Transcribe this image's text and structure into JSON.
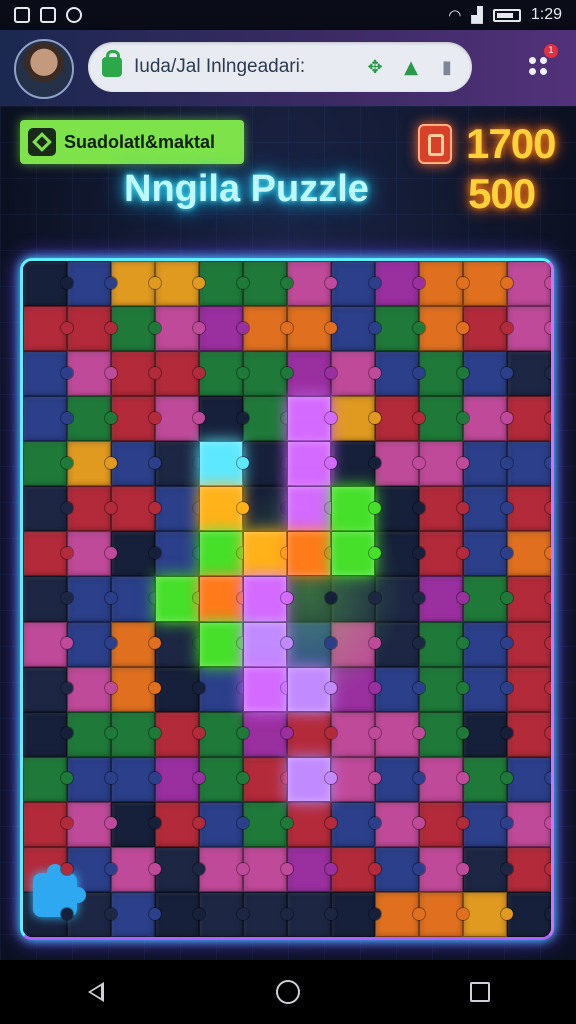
{
  "status_bar": {
    "time": "1:29",
    "left_icons": [
      "notification-icon",
      "app-icon",
      "download-icon"
    ],
    "right_icons": [
      "wifi-icon",
      "signal-icon",
      "battery-icon"
    ]
  },
  "browser": {
    "url_text": "Iuda/Jal Inlngeadari:",
    "url_icons": [
      "lock-icon",
      "puzzle-ext-icon",
      "bookmark-icon",
      "tab-icon"
    ],
    "menu_badge": "1"
  },
  "game": {
    "badge_label": "Suadolatl&maktal",
    "title": "Nngila Puzzle",
    "score": "1700",
    "secondary_score": "500"
  },
  "board": {
    "columns": 12,
    "rows": 15,
    "palette": {
      "r": "#b32a3a",
      "g": "#1f7a3a",
      "o": "#e0701f",
      "p": "#9a2fa0",
      "b": "#2b3f8a",
      "m": "#c04a9a",
      "d": "#1d2744",
      "y": "#e09a20",
      "k": "#17203a",
      "G": "#46e02a",
      "Y": "#ffb21a",
      "C": "#5ee8ff",
      "V": "#d46aff",
      "O": "#ff7a1a",
      "L": "#c28aff"
    },
    "pattern": [
      "kbyyggmbpoom",
      "rrgmpoobgorm",
      "bmrrggpmbgbd",
      "bgrmkgVyrgmr",
      "gybdCkVkmmbb",
      "drrbYkVGkrbr",
      "rmkbGYOGkrbo",
      "dbbGOVkddpgr",
      "mbodGLbmdgbr",
      "dmokbVLpbgbr",
      "kggrgprmmgkr",
      "gbbpgrLmbmgb",
      "rmkrbgrbmrbm",
      "rbmdmmprbmdr",
      "kdbkdddkooyk"
    ]
  }
}
